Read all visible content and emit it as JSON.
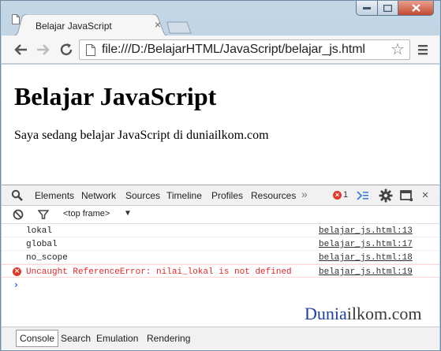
{
  "browser": {
    "tab_title": "Belajar JavaScript",
    "url": "file:///D:/BelajarHTML/JavaScript/belajar_js.html"
  },
  "page": {
    "heading": "Belajar JavaScript",
    "paragraph": "Saya sedang belajar JavaScript di duniailkom.com"
  },
  "devtools": {
    "tabs": [
      "Elements",
      "Network",
      "Sources",
      "Timeline",
      "Profiles",
      "Resources"
    ],
    "more": "»",
    "error_count": "1",
    "close": "×",
    "frame_selector": "<top frame>",
    "console_lines": [
      {
        "message": "lokal",
        "source": "belajar_js.html:13",
        "level": "log"
      },
      {
        "message": "global",
        "source": "belajar_js.html:17",
        "level": "log"
      },
      {
        "message": "no_scope",
        "source": "belajar_js.html:18",
        "level": "log"
      },
      {
        "message": "Uncaught ReferenceError: nilai_lokal is not defined",
        "source": "belajar_js.html:19",
        "level": "error"
      }
    ],
    "prompt": "›",
    "drawer_tabs": [
      "Console",
      "Search",
      "Emulation",
      "Rendering"
    ]
  },
  "watermark": {
    "part1": "Dunia",
    "part2": "ilkom.com"
  }
}
